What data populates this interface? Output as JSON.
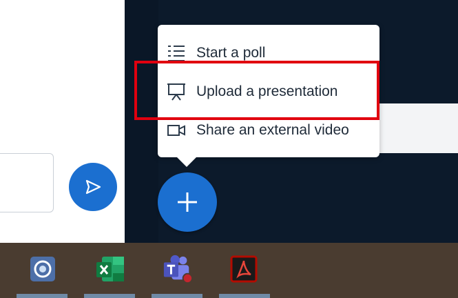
{
  "menu": {
    "items": [
      {
        "label": "Start a poll",
        "icon": "list-icon"
      },
      {
        "label": "Upload a presentation",
        "icon": "presentation-icon"
      },
      {
        "label": "Share an external video",
        "icon": "video-icon"
      }
    ]
  },
  "colors": {
    "accent": "#1b6fd0",
    "highlight": "#e1000f",
    "dark_bg": "#0c1a2b",
    "taskbar": "#4a3c30"
  },
  "taskbar": {
    "apps": [
      "app-icon",
      "excel-icon",
      "teams-icon",
      "acrobat-icon"
    ]
  }
}
